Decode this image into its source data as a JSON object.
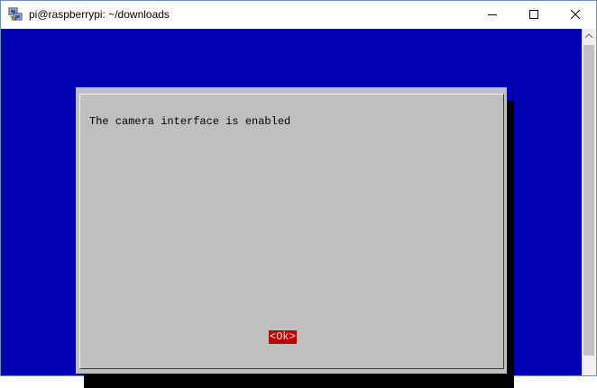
{
  "window": {
    "title": "pi@raspberrypi: ~/downloads",
    "icon": "putty-icon",
    "controls": [
      "minimize-icon",
      "maximize-icon",
      "close-icon"
    ]
  },
  "terminal": {
    "background": "#0000b2"
  },
  "dialog": {
    "message": "The camera interface is enabled",
    "ok_label": "<Ok>",
    "background": "#bfbfbf",
    "button_color": "#c00000"
  }
}
